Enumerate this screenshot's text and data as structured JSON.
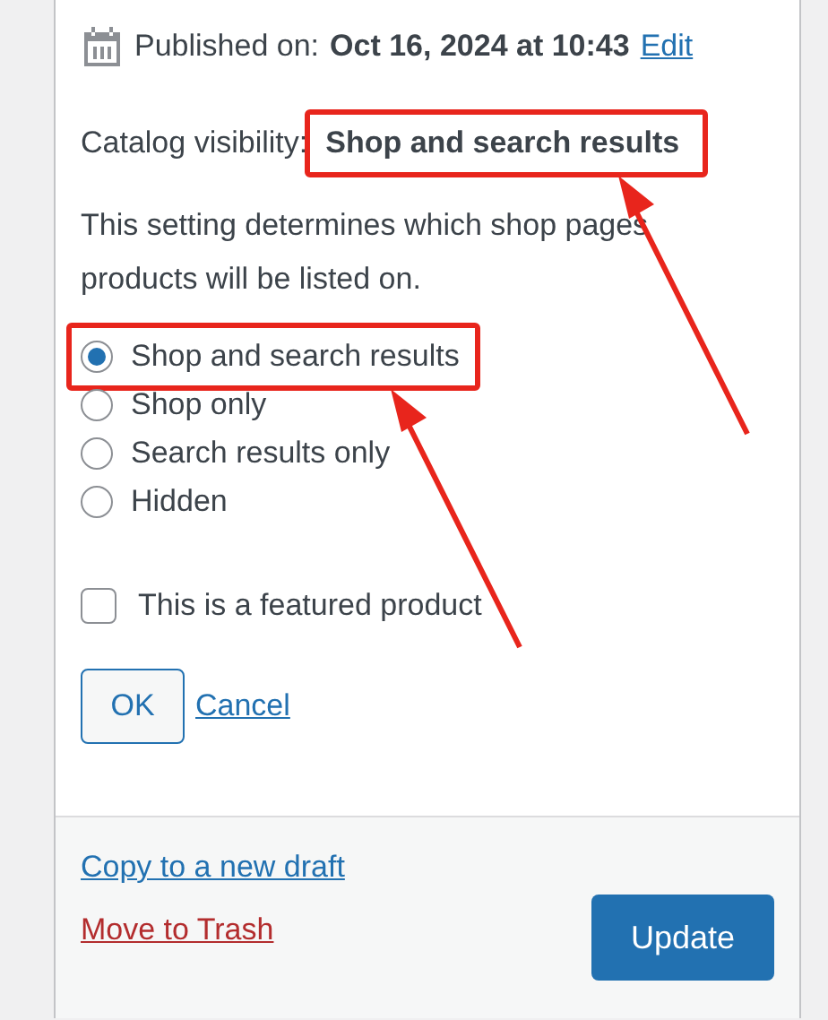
{
  "published": {
    "label": "Published on:",
    "date": "Oct 16, 2024 at 10:43",
    "edit_link": "Edit"
  },
  "catalog": {
    "label": "Catalog visibility:",
    "value": "Shop and search results",
    "highlighted": true
  },
  "description": "This setting determines which shop pages products will be listed on.",
  "visibility_options": [
    {
      "label": "Shop and search results",
      "selected": true,
      "highlighted": true
    },
    {
      "label": "Shop only",
      "selected": false,
      "highlighted": false
    },
    {
      "label": "Search results only",
      "selected": false,
      "highlighted": false
    },
    {
      "label": "Hidden",
      "selected": false,
      "highlighted": false
    }
  ],
  "featured": {
    "label": "This is a featured product",
    "checked": false
  },
  "ok_button": "OK",
  "cancel_link": "Cancel",
  "footer": {
    "copy_link": "Copy to a new draft",
    "trash_link": "Move to Trash",
    "update_button": "Update"
  }
}
